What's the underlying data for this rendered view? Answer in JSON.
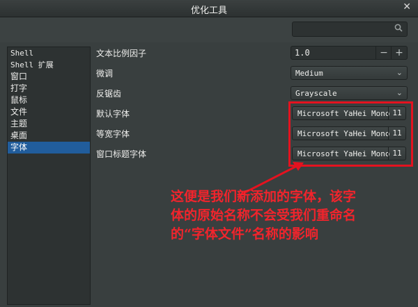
{
  "window": {
    "title": "优化工具",
    "close_glyph": "✕"
  },
  "search": {
    "placeholder": "",
    "icon": "search-icon"
  },
  "sidebar": {
    "items": [
      {
        "label": "Shell",
        "active": false
      },
      {
        "label": "Shell 扩展",
        "active": false
      },
      {
        "label": "窗口",
        "active": false
      },
      {
        "label": "打字",
        "active": false
      },
      {
        "label": "鼠标",
        "active": false
      },
      {
        "label": "文件",
        "active": false
      },
      {
        "label": "主题",
        "active": false
      },
      {
        "label": "桌面",
        "active": false
      },
      {
        "label": "字体",
        "active": true
      }
    ]
  },
  "settings": {
    "scale": {
      "label": "文本比例因子",
      "value": "1.0",
      "minus": "−",
      "plus": "+"
    },
    "hinting": {
      "label": "微调",
      "value": "Medium"
    },
    "antialias": {
      "label": "反锯齿",
      "value": "Grayscale"
    },
    "default_font": {
      "label": "默认字体",
      "name": "Microsoft YaHei Mono",
      "size": "11"
    },
    "monospace_font": {
      "label": "等宽字体",
      "name": "Microsoft YaHei Mono",
      "size": "11"
    },
    "titlebar_font": {
      "label": "窗口标题字体",
      "name": "Microsoft YaHei Mono",
      "size": "11"
    }
  },
  "annotation": {
    "lines": [
      "这便是我们新添加的字体，该字",
      "体的原始名称不会受我们重命名",
      "的“字体文件”名称的影响"
    ],
    "color": "#f2242c"
  }
}
